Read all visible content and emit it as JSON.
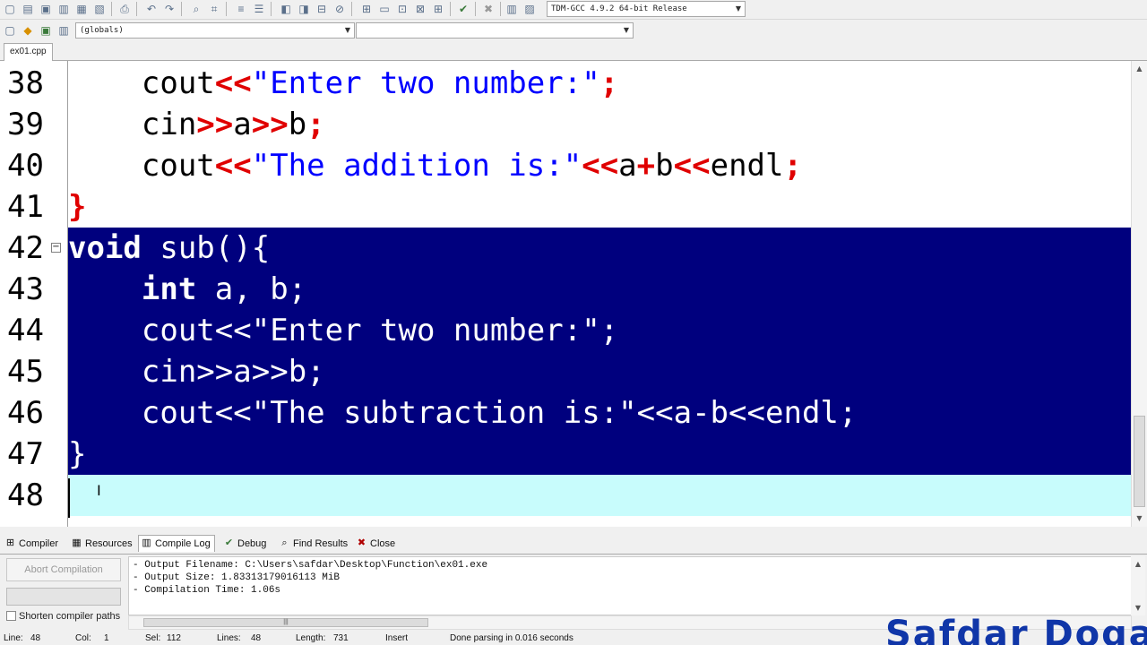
{
  "toolbar": {
    "compiler_select": "TDM-GCC 4.9.2 64-bit Release"
  },
  "scope_bar": {
    "globals_select": "(globals)",
    "member_select": ""
  },
  "file_tabs": [
    {
      "label": "ex01.cpp"
    }
  ],
  "editor": {
    "lines": [
      {
        "num": "38",
        "indent": "    ",
        "text": "cout<<\"Enter two number:\";"
      },
      {
        "num": "39",
        "indent": "    ",
        "text": "cin>>a>>b;"
      },
      {
        "num": "40",
        "indent": "    ",
        "text": "cout<<\"The addition is:\"<<a+b<<endl;"
      },
      {
        "num": "41",
        "indent": "",
        "text": "}"
      },
      {
        "num": "42",
        "indent": "",
        "text": "void sub(){"
      },
      {
        "num": "43",
        "indent": "    ",
        "text": "int a, b;"
      },
      {
        "num": "44",
        "indent": "    ",
        "text": "cout<<\"Enter two number:\";"
      },
      {
        "num": "45",
        "indent": "    ",
        "text": "cin>>a>>b;"
      },
      {
        "num": "46",
        "indent": "    ",
        "text": "cout<<\"The subtraction is:\"<<a-b<<endl;"
      },
      {
        "num": "47",
        "indent": "",
        "text": "}"
      },
      {
        "num": "48",
        "indent": "",
        "text": ""
      }
    ],
    "selected_lines": [
      "42",
      "43",
      "44",
      "45",
      "46",
      "47"
    ],
    "current_line": "48",
    "colors": {
      "selection": "#00007e",
      "current_line": "#c8fcfc",
      "string": "#0000ff",
      "operator": "#e00000"
    }
  },
  "bottom_tabs": [
    {
      "label": "Compiler",
      "icon": "grid-icon"
    },
    {
      "label": "Resources",
      "icon": "resources-icon"
    },
    {
      "label": "Compile Log",
      "icon": "bar-chart-icon"
    },
    {
      "label": "Debug",
      "icon": "check-icon"
    },
    {
      "label": "Find Results",
      "icon": "find-icon"
    },
    {
      "label": "Close",
      "icon": "close-icon"
    }
  ],
  "active_bottom_tab": "Compile Log",
  "compile_panel": {
    "abort_label": "Abort Compilation",
    "shorten_label": "Shorten compiler paths",
    "shorten_checked": false,
    "log_lines": [
      "- Output Filename: C:\\Users\\safdar\\Desktop\\Function\\ex01.exe",
      "- Output Size: 1.83313179016113 MiB",
      "- Compilation Time: 1.06s"
    ]
  },
  "status_bar": {
    "line_label": "Line:",
    "line_value": "48",
    "col_label": "Col:",
    "col_value": "1",
    "sel_label": "Sel:",
    "sel_value": "112",
    "lines_label": "Lines:",
    "lines_value": "48",
    "length_label": "Length:",
    "length_value": "731",
    "mode": "Insert",
    "message": "Done parsing in 0.016 seconds"
  },
  "watermark": "Safdar Dogar"
}
